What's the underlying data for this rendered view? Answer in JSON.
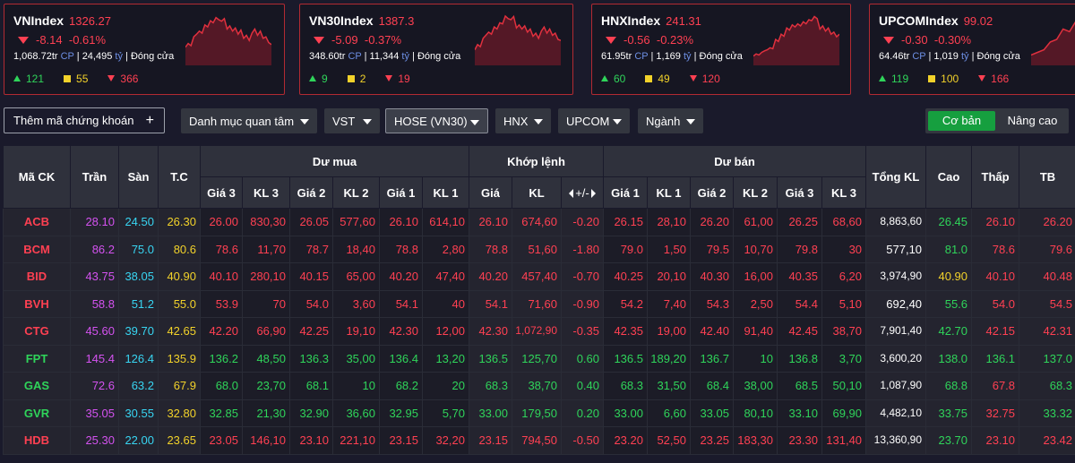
{
  "cards": [
    {
      "name": "VNIndex",
      "value": "1326.27",
      "change": "-8.14",
      "pct": "-0.61%",
      "volume": "1,068.72tr",
      "vol_unit": "CP",
      "turnover": "24,495",
      "to_unit": "tỷ",
      "status": "Đóng cửa",
      "up": "121",
      "flat": "55",
      "down": "366",
      "spark": [
        0.35,
        0.42,
        0.38,
        0.55,
        0.6,
        0.66,
        0.62,
        0.78,
        0.74,
        0.86,
        0.82,
        0.92,
        0.88,
        0.85,
        0.9,
        0.7,
        0.76,
        0.66,
        0.72,
        0.6,
        0.68,
        0.52,
        0.58,
        0.48,
        0.62,
        0.7,
        0.58,
        0.66,
        0.52,
        0.55,
        0.44,
        0.4
      ]
    },
    {
      "name": "VN30Index",
      "value": "1387.3",
      "change": "-5.09",
      "pct": "-0.37%",
      "volume": "348.60tr",
      "vol_unit": "CP",
      "turnover": "11,344",
      "to_unit": "tỷ",
      "status": "Đóng cửa",
      "up": "9",
      "flat": "2",
      "down": "19",
      "spark": [
        0.3,
        0.4,
        0.36,
        0.52,
        0.58,
        0.64,
        0.6,
        0.74,
        0.7,
        0.82,
        0.8,
        0.95,
        0.9,
        0.88,
        0.94,
        0.72,
        0.78,
        0.7,
        0.76,
        0.64,
        0.7,
        0.56,
        0.62,
        0.52,
        0.66,
        0.74,
        0.62,
        0.7,
        0.58,
        0.62,
        0.5,
        0.48
      ]
    },
    {
      "name": "HNXIndex",
      "value": "241.31",
      "change": "-0.56",
      "pct": "-0.23%",
      "volume": "61.95tr",
      "vol_unit": "CP",
      "turnover": "1,169",
      "to_unit": "tỷ",
      "status": "Đóng cửa",
      "up": "60",
      "flat": "49",
      "down": "120",
      "spark": [
        0.18,
        0.22,
        0.2,
        0.25,
        0.28,
        0.3,
        0.34,
        0.32,
        0.5,
        0.46,
        0.6,
        0.56,
        0.72,
        0.68,
        0.78,
        0.74,
        0.8,
        0.76,
        0.84,
        0.8,
        0.88,
        0.86,
        0.94,
        0.9,
        0.7,
        0.76,
        0.66,
        0.72,
        0.6,
        0.64,
        0.55,
        0.6
      ]
    },
    {
      "name": "UPCOMIndex",
      "value": "99.02",
      "change": "-0.30",
      "pct": "-0.30%",
      "volume": "64.46tr",
      "vol_unit": "CP",
      "turnover": "1,019",
      "to_unit": "tỷ",
      "status": "Đóng cửa",
      "up": "119",
      "flat": "100",
      "down": "166",
      "spark": [
        0.2,
        0.25,
        0.3,
        0.45,
        0.5,
        0.7,
        0.65,
        0.85
      ]
    }
  ],
  "toolbar": {
    "add_label": "Thêm mã chứng khoán",
    "plus": "+",
    "watchlist": "Danh mục quan tâm",
    "vst": "VST",
    "hose": "HOSE (VN30)",
    "hnx": "HNX",
    "upcom": "UPCOM",
    "sector": "Ngành",
    "basic": "Cơ bản",
    "advanced": "Nâng cao"
  },
  "headers": {
    "code": "Mã CK",
    "ceil": "Trần",
    "floor": "Sàn",
    "ref": "T.C",
    "bid": "Dư mua",
    "match": "Khớp lệnh",
    "ask": "Dư bán",
    "total": "Tổng KL",
    "high": "Cao",
    "low": "Thấp",
    "avg": "TB",
    "p3": "Giá 3",
    "v3": "KL 3",
    "p2": "Giá 2",
    "v2": "KL 2",
    "p1": "Giá 1",
    "v1": "KL 1",
    "mp": "Giá",
    "mv": "KL",
    "pm": "+/-",
    "ap1": "Giá 1",
    "av1": "KL 1",
    "ap2": "Giá 2",
    "av2": "KL 2",
    "ap3": "Giá 3",
    "av3": "KL 3"
  },
  "colors": {
    "r": "#ff4052",
    "g": "#2fd45a",
    "y": "#f2d22a",
    "p": "#d452f0",
    "c": "#38d5f2",
    "w": "#ffffff"
  },
  "rows": [
    {
      "code": "ACB",
      "cc": "r",
      "cells": [
        [
          "28.10",
          "p"
        ],
        [
          "24.50",
          "c"
        ],
        [
          "26.30",
          "y"
        ],
        [
          "26.00",
          "r"
        ],
        [
          "830,30",
          "r"
        ],
        [
          "26.05",
          "r"
        ],
        [
          "577,60",
          "r"
        ],
        [
          "26.10",
          "r"
        ],
        [
          "614,10",
          "r"
        ],
        [
          "26.10",
          "r"
        ],
        [
          "674,60",
          "r"
        ],
        [
          "-0.20",
          "r"
        ],
        [
          "26.15",
          "r"
        ],
        [
          "28,10",
          "r"
        ],
        [
          "26.20",
          "r"
        ],
        [
          "61,00",
          "r"
        ],
        [
          "26.25",
          "r"
        ],
        [
          "68,60",
          "r"
        ],
        [
          "8,863,60",
          "w"
        ],
        [
          "26.45",
          "g"
        ],
        [
          "26.10",
          "r"
        ],
        [
          "26.20",
          "r"
        ]
      ]
    },
    {
      "code": "BCM",
      "cc": "r",
      "cells": [
        [
          "86.2",
          "p"
        ],
        [
          "75.0",
          "c"
        ],
        [
          "80.6",
          "y"
        ],
        [
          "78.6",
          "r"
        ],
        [
          "11,70",
          "r"
        ],
        [
          "78.7",
          "r"
        ],
        [
          "18,40",
          "r"
        ],
        [
          "78.8",
          "r"
        ],
        [
          "2,80",
          "r"
        ],
        [
          "78.8",
          "r"
        ],
        [
          "51,60",
          "r"
        ],
        [
          "-1.80",
          "r"
        ],
        [
          "79.0",
          "r"
        ],
        [
          "1,50",
          "r"
        ],
        [
          "79.5",
          "r"
        ],
        [
          "10,70",
          "r"
        ],
        [
          "79.8",
          "r"
        ],
        [
          "30",
          "r"
        ],
        [
          "577,10",
          "w"
        ],
        [
          "81.0",
          "g"
        ],
        [
          "78.6",
          "r"
        ],
        [
          "79.6",
          "r"
        ]
      ]
    },
    {
      "code": "BID",
      "cc": "r",
      "cells": [
        [
          "43.75",
          "p"
        ],
        [
          "38.05",
          "c"
        ],
        [
          "40.90",
          "y"
        ],
        [
          "40.10",
          "r"
        ],
        [
          "280,10",
          "r"
        ],
        [
          "40.15",
          "r"
        ],
        [
          "65,00",
          "r"
        ],
        [
          "40.20",
          "r"
        ],
        [
          "47,40",
          "r"
        ],
        [
          "40.20",
          "r"
        ],
        [
          "457,40",
          "r"
        ],
        [
          "-0.70",
          "r"
        ],
        [
          "40.25",
          "r"
        ],
        [
          "20,10",
          "r"
        ],
        [
          "40.30",
          "r"
        ],
        [
          "16,00",
          "r"
        ],
        [
          "40.35",
          "r"
        ],
        [
          "6,20",
          "r"
        ],
        [
          "3,974,90",
          "w"
        ],
        [
          "40.90",
          "y"
        ],
        [
          "40.10",
          "r"
        ],
        [
          "40.48",
          "r"
        ]
      ]
    },
    {
      "code": "BVH",
      "cc": "r",
      "cells": [
        [
          "58.8",
          "p"
        ],
        [
          "51.2",
          "c"
        ],
        [
          "55.0",
          "y"
        ],
        [
          "53.9",
          "r"
        ],
        [
          "70",
          "r"
        ],
        [
          "54.0",
          "r"
        ],
        [
          "3,60",
          "r"
        ],
        [
          "54.1",
          "r"
        ],
        [
          "40",
          "r"
        ],
        [
          "54.1",
          "r"
        ],
        [
          "71,60",
          "r"
        ],
        [
          "-0.90",
          "r"
        ],
        [
          "54.2",
          "r"
        ],
        [
          "7,40",
          "r"
        ],
        [
          "54.3",
          "r"
        ],
        [
          "2,50",
          "r"
        ],
        [
          "54.4",
          "r"
        ],
        [
          "5,10",
          "r"
        ],
        [
          "692,40",
          "w"
        ],
        [
          "55.6",
          "g"
        ],
        [
          "54.0",
          "r"
        ],
        [
          "54.5",
          "r"
        ]
      ]
    },
    {
      "code": "CTG",
      "cc": "r",
      "cells": [
        [
          "45.60",
          "p"
        ],
        [
          "39.70",
          "c"
        ],
        [
          "42.65",
          "y"
        ],
        [
          "42.20",
          "r"
        ],
        [
          "66,90",
          "r"
        ],
        [
          "42.25",
          "r"
        ],
        [
          "19,10",
          "r"
        ],
        [
          "42.30",
          "r"
        ],
        [
          "12,00",
          "r"
        ],
        [
          "42.30",
          "r"
        ],
        [
          "1,072,90",
          "r"
        ],
        [
          "-0.35",
          "r"
        ],
        [
          "42.35",
          "r"
        ],
        [
          "19,00",
          "r"
        ],
        [
          "42.40",
          "r"
        ],
        [
          "91,40",
          "r"
        ],
        [
          "42.45",
          "r"
        ],
        [
          "38,70",
          "r"
        ],
        [
          "7,901,40",
          "w"
        ],
        [
          "42.70",
          "g"
        ],
        [
          "42.15",
          "r"
        ],
        [
          "42.31",
          "r"
        ]
      ]
    },
    {
      "code": "FPT",
      "cc": "g",
      "cells": [
        [
          "145.4",
          "p"
        ],
        [
          "126.4",
          "c"
        ],
        [
          "135.9",
          "y"
        ],
        [
          "136.2",
          "g"
        ],
        [
          "48,50",
          "g"
        ],
        [
          "136.3",
          "g"
        ],
        [
          "35,00",
          "g"
        ],
        [
          "136.4",
          "g"
        ],
        [
          "13,20",
          "g"
        ],
        [
          "136.5",
          "g"
        ],
        [
          "125,70",
          "g"
        ],
        [
          "0.60",
          "g"
        ],
        [
          "136.5",
          "g"
        ],
        [
          "189,20",
          "g"
        ],
        [
          "136.7",
          "g"
        ],
        [
          "10",
          "g"
        ],
        [
          "136.8",
          "g"
        ],
        [
          "3,70",
          "g"
        ],
        [
          "3,600,20",
          "w"
        ],
        [
          "138.0",
          "g"
        ],
        [
          "136.1",
          "g"
        ],
        [
          "137.0",
          "g"
        ]
      ]
    },
    {
      "code": "GAS",
      "cc": "g",
      "cells": [
        [
          "72.6",
          "p"
        ],
        [
          "63.2",
          "c"
        ],
        [
          "67.9",
          "y"
        ],
        [
          "68.0",
          "g"
        ],
        [
          "23,70",
          "g"
        ],
        [
          "68.1",
          "g"
        ],
        [
          "10",
          "g"
        ],
        [
          "68.2",
          "g"
        ],
        [
          "20",
          "g"
        ],
        [
          "68.3",
          "g"
        ],
        [
          "38,70",
          "g"
        ],
        [
          "0.40",
          "g"
        ],
        [
          "68.3",
          "g"
        ],
        [
          "31,50",
          "g"
        ],
        [
          "68.4",
          "g"
        ],
        [
          "38,00",
          "g"
        ],
        [
          "68.5",
          "g"
        ],
        [
          "50,10",
          "g"
        ],
        [
          "1,087,90",
          "w"
        ],
        [
          "68.8",
          "g"
        ],
        [
          "67.8",
          "r"
        ],
        [
          "68.3",
          "g"
        ]
      ]
    },
    {
      "code": "GVR",
      "cc": "g",
      "cells": [
        [
          "35.05",
          "p"
        ],
        [
          "30.55",
          "c"
        ],
        [
          "32.80",
          "y"
        ],
        [
          "32.85",
          "g"
        ],
        [
          "21,30",
          "g"
        ],
        [
          "32.90",
          "g"
        ],
        [
          "36,60",
          "g"
        ],
        [
          "32.95",
          "g"
        ],
        [
          "5,70",
          "g"
        ],
        [
          "33.00",
          "g"
        ],
        [
          "179,50",
          "g"
        ],
        [
          "0.20",
          "g"
        ],
        [
          "33.00",
          "g"
        ],
        [
          "6,60",
          "g"
        ],
        [
          "33.05",
          "g"
        ],
        [
          "80,10",
          "g"
        ],
        [
          "33.10",
          "g"
        ],
        [
          "69,90",
          "g"
        ],
        [
          "4,482,10",
          "w"
        ],
        [
          "33.75",
          "g"
        ],
        [
          "32.75",
          "r"
        ],
        [
          "33.32",
          "g"
        ]
      ]
    },
    {
      "code": "HDB",
      "cc": "r",
      "cells": [
        [
          "25.30",
          "p"
        ],
        [
          "22.00",
          "c"
        ],
        [
          "23.65",
          "y"
        ],
        [
          "23.05",
          "r"
        ],
        [
          "146,10",
          "r"
        ],
        [
          "23.10",
          "r"
        ],
        [
          "221,10",
          "r"
        ],
        [
          "23.15",
          "r"
        ],
        [
          "32,20",
          "r"
        ],
        [
          "23.15",
          "r"
        ],
        [
          "794,50",
          "r"
        ],
        [
          "-0.50",
          "r"
        ],
        [
          "23.20",
          "r"
        ],
        [
          "52,50",
          "r"
        ],
        [
          "23.25",
          "r"
        ],
        [
          "183,30",
          "r"
        ],
        [
          "23.30",
          "r"
        ],
        [
          "131,40",
          "r"
        ],
        [
          "13,360,90",
          "w"
        ],
        [
          "23.70",
          "g"
        ],
        [
          "23.10",
          "r"
        ],
        [
          "23.42",
          "r"
        ]
      ]
    }
  ]
}
